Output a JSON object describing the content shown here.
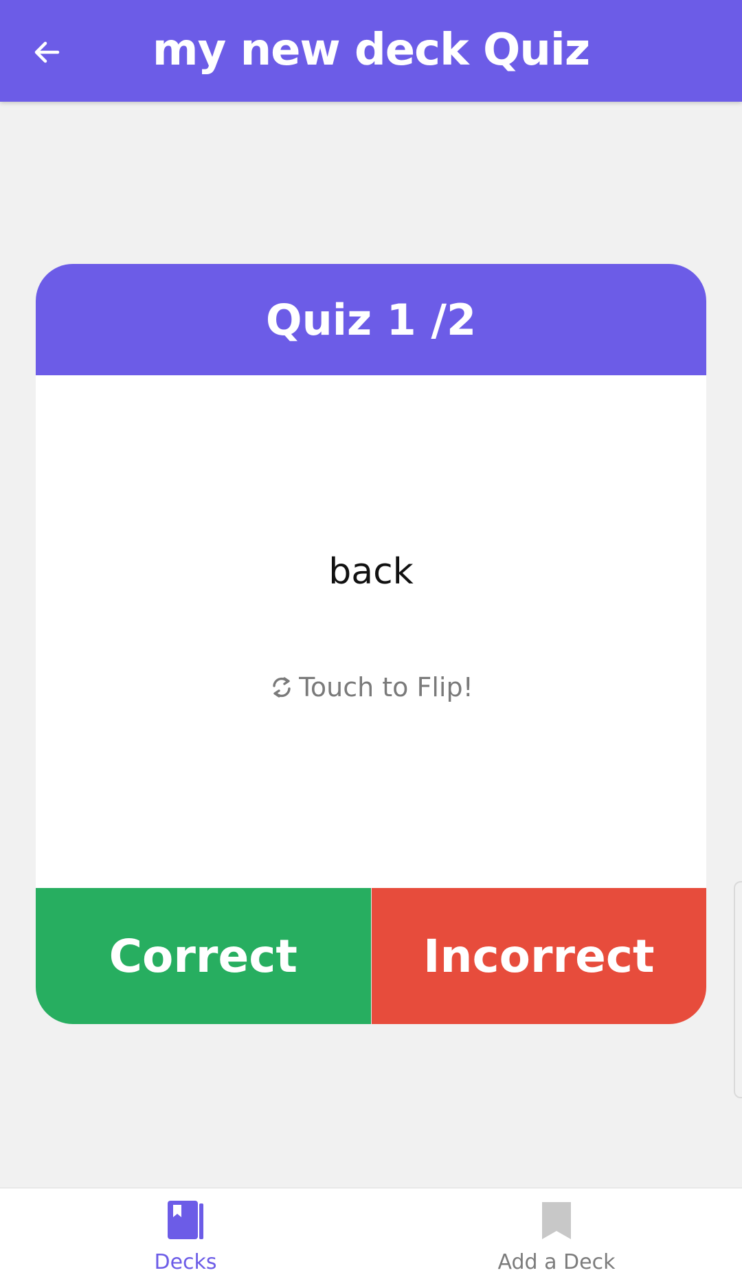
{
  "header": {
    "title": "my new deck Quiz",
    "back_icon": "arrow-left-icon"
  },
  "card": {
    "header": "Quiz 1 /2",
    "face_text": "back",
    "flip_hint": "Touch to Flip!",
    "flip_icon": "flip-arrows-icon",
    "correct_label": "Correct",
    "incorrect_label": "Incorrect"
  },
  "bottom_nav": {
    "items": [
      {
        "label": "Decks",
        "icon": "book-icon",
        "active": true
      },
      {
        "label": "Add a Deck",
        "icon": "bookmark-icon",
        "active": false
      }
    ]
  },
  "colors": {
    "primary": "#6c5ce7",
    "correct": "#27ae60",
    "incorrect": "#e74c3c",
    "background": "#f1f1f1",
    "inactive": "#c8c8c8"
  }
}
